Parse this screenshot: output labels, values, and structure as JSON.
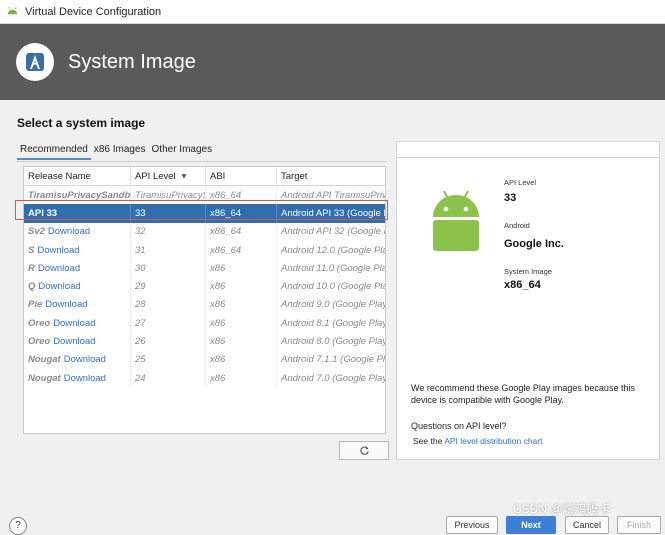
{
  "window": {
    "title": "Virtual Device Configuration"
  },
  "banner": {
    "title": "System Image"
  },
  "main": {
    "heading": "Select a system image",
    "tabs": [
      {
        "label": "Recommended",
        "active": true
      },
      {
        "label": "x86 Images",
        "active": false
      },
      {
        "label": "Other Images",
        "active": false
      }
    ],
    "table": {
      "headers": [
        "Release Name",
        "API Level",
        "ABI",
        "Target"
      ],
      "sort_indicator": "▾",
      "rows": [
        {
          "name": "TiramisuPrivacySandbox",
          "download": "",
          "api": "TiramisuPrivacySa",
          "abi": "x86_64",
          "target": "Android API TiramisuPrivacy",
          "state": "available"
        },
        {
          "name": "API 33",
          "download": "",
          "api": "33",
          "abi": "x86_64",
          "target": "Android API 33 (Google P",
          "state": "selected"
        },
        {
          "name": "Sv2",
          "download": "Download",
          "api": "32",
          "abi": "x86_64",
          "target": "Android API 32 (Google P",
          "state": "download"
        },
        {
          "name": "S",
          "download": "Download",
          "api": "31",
          "abi": "x86_64",
          "target": "Android 12.0 (Google Play",
          "state": "download"
        },
        {
          "name": "R",
          "download": "Download",
          "api": "30",
          "abi": "x86",
          "target": "Android 11.0 (Google Play",
          "state": "download"
        },
        {
          "name": "Q",
          "download": "Download",
          "api": "29",
          "abi": "x86",
          "target": "Android 10.0 (Google Play",
          "state": "download"
        },
        {
          "name": "Pie",
          "download": "Download",
          "api": "28",
          "abi": "x86",
          "target": "Android 9.0 (Google Play)",
          "state": "download"
        },
        {
          "name": "Oreo",
          "download": "Download",
          "api": "27",
          "abi": "x86",
          "target": "Android 8.1 (Google Play)",
          "state": "download"
        },
        {
          "name": "Oreo",
          "download": "Download",
          "api": "26",
          "abi": "x86",
          "target": "Android 8.0 (Google Play)",
          "state": "download"
        },
        {
          "name": "Nougat",
          "download": "Download",
          "api": "25",
          "abi": "x86",
          "target": "Android 7.1.1 (Google Pla",
          "state": "download"
        },
        {
          "name": "Nougat",
          "download": "Download",
          "api": "24",
          "abi": "x86",
          "target": "Android 7.0 (Google Play)",
          "state": "download"
        }
      ]
    },
    "refresh_icon": "refresh-icon"
  },
  "details": {
    "api_level_label": "API Level",
    "api_level": "33",
    "android_label": "Android",
    "vendor": "Google Inc.",
    "system_image_label": "System Image",
    "system_image": "x86_64",
    "recommendation": "We recommend these Google Play images because this device is compatible with Google Play.",
    "question": "Questions on API level?",
    "see_prefix": "See the ",
    "see_link": "API level distribution chart"
  },
  "footer": {
    "help": "?",
    "previous": "Previous",
    "next": "Next",
    "cancel": "Cancel",
    "finish": "Finish"
  },
  "watermark": "CSDN @炫鸡码卡",
  "colors": {
    "banner_bg": "#5a5a5a",
    "selection": "#2f6fb0",
    "link": "#2f6fd6",
    "android_green": "#8bc34a",
    "highlight_box": "#e05050"
  }
}
